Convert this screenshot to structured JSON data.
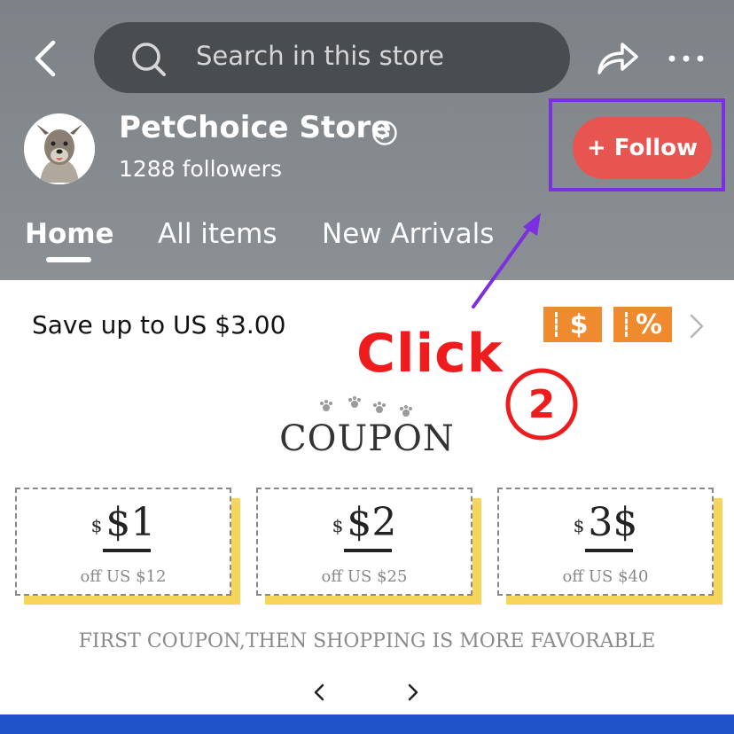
{
  "header": {
    "search_placeholder": "Search in this store",
    "store_name": "PetChoice Store",
    "followers": "1288 followers",
    "follow_label": "+ Follow",
    "tabs": [
      {
        "label": "Home",
        "active": true
      },
      {
        "label": "All items",
        "active": false
      },
      {
        "label": "New Arrivals",
        "active": false
      }
    ],
    "icons": {
      "back": "chevron-left-icon",
      "search": "search-icon",
      "share": "share-arrow-icon",
      "more": "more-dots-icon",
      "store_info": "chevron-right-circle-icon"
    }
  },
  "annotation": {
    "click_text": "Click",
    "step": "2",
    "color": "#ee1c1c",
    "box_color": "#7b2fe0"
  },
  "promo": {
    "text": "Save up to US $3.00",
    "tags": [
      "$",
      "%"
    ],
    "tag_color": "#ef8a2e"
  },
  "coupon_section": {
    "title": "COUPON",
    "coupons": [
      {
        "currency": "$",
        "amount": "$1",
        "condition": "off US $12"
      },
      {
        "currency": "$",
        "amount": "$2",
        "condition": "off US $25"
      },
      {
        "currency": "$",
        "amount": "3$",
        "condition": "off US $40"
      }
    ],
    "tagline": "FIRST COUPON,THEN SHOPPING IS MORE FAVORABLE",
    "accent": "#f5d55a"
  },
  "colors": {
    "header_bg": "#84898d",
    "follow_button": "#e85450",
    "bottom_bar": "#1f52c6"
  }
}
